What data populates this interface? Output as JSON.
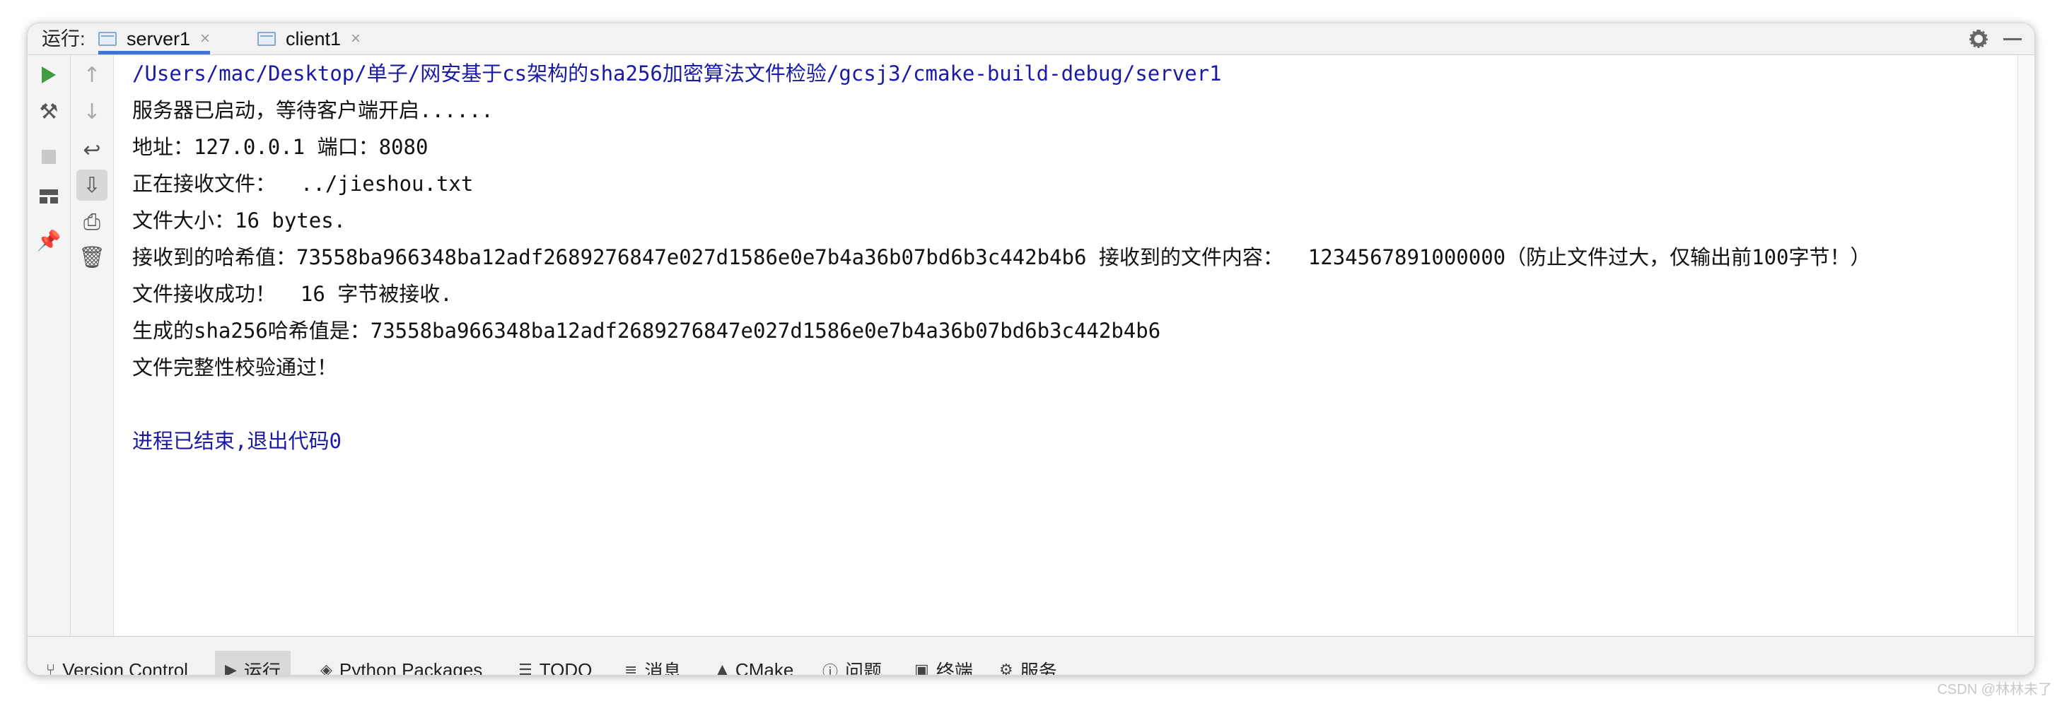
{
  "header": {
    "run_label": "运行:",
    "tabs": [
      {
        "label": "server1",
        "active": true
      },
      {
        "label": "client1",
        "active": false
      }
    ]
  },
  "console": {
    "lines": [
      "/Users/mac/Desktop/单子/网安基于cs架构的sha256加密算法文件检验/gcsj3/cmake-build-debug/server1",
      "服务器已启动，等待客户端开启......",
      "地址：127.0.0.1 端口：8080",
      "正在接收文件：  ../jieshou.txt",
      "文件大小：16 bytes.",
      "接收到的哈希值：73558ba966348ba12adf2689276847e027d1586e0e7b4a36b07bd6b3c442b4b6 接收到的文件内容：  1234567891000000（防止文件过大，仅输出前100字节！）",
      "文件接收成功！  16 字节被接收.",
      "生成的sha256哈希值是：73558ba966348ba12adf2689276847e027d1586e0e7b4a36b07bd6b3c442b4b6",
      "文件完整性校验通过！",
      "",
      "进程已结束,退出代码0"
    ]
  },
  "bottom_bar": {
    "items": [
      {
        "label": "Version Control",
        "icon": "branch-icon"
      },
      {
        "label": "运行",
        "icon": "run-icon",
        "active": true
      },
      {
        "label": "Python Packages",
        "icon": "packages-icon"
      },
      {
        "label": "TODO",
        "icon": "todo-icon"
      },
      {
        "label": "消息",
        "icon": "messages-icon"
      },
      {
        "label": "CMake",
        "icon": "cmake-icon"
      },
      {
        "label": "问题",
        "icon": "problems-icon"
      },
      {
        "label": "终端",
        "icon": "terminal-icon"
      },
      {
        "label": "服务",
        "icon": "services-icon"
      }
    ]
  },
  "watermark": "CSDN @林林未了",
  "colors": {
    "path_text": "#1a1aa6",
    "accent_tab": "#3d74d6",
    "run_green": "#3f9d3f"
  }
}
